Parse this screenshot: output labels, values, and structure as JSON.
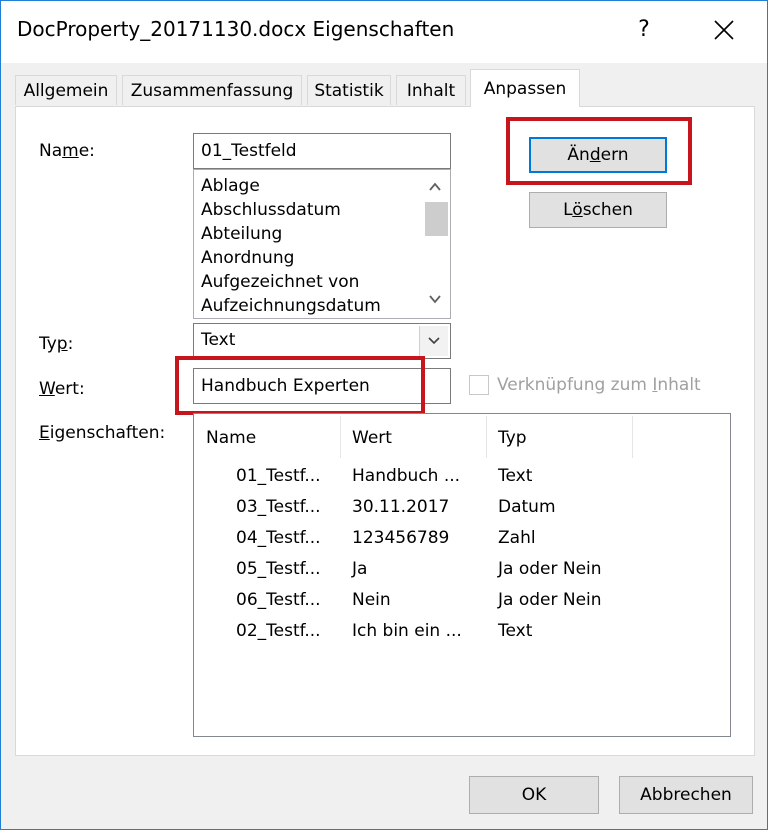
{
  "window": {
    "title": "DocProperty_20171130.docx Eigenschaften",
    "help": "?"
  },
  "tabs": [
    {
      "label": "Allgemein"
    },
    {
      "label": "Zusammenfassung"
    },
    {
      "label": "Statistik"
    },
    {
      "label": "Inhalt"
    },
    {
      "label": "Anpassen",
      "active": true
    }
  ],
  "form": {
    "name_label_pre": "Na",
    "name_label_u": "m",
    "name_label_post": "e:",
    "name_value": "01_Testfeld",
    "name_list": [
      "Ablage",
      "Abschlussdatum",
      "Abteilung",
      "Anordnung",
      "Aufgezeichnet von",
      "Aufzeichnungsdatum"
    ],
    "type_label_pre": "Ty",
    "type_label_u": "p",
    "type_label_post": ":",
    "type_value": "Text",
    "value_label_u": "W",
    "value_label_post": "ert:",
    "value_value": "Handbuch Experten",
    "link_checkbox_pre": "Verknüpfung zum ",
    "link_checkbox_u": "I",
    "link_checkbox_post": "nhalt",
    "link_checked": false,
    "props_label_u": "E",
    "props_label_post": "igenschaften:"
  },
  "buttons": {
    "change_pre": "Än",
    "change_u": "d",
    "change_post": "ern",
    "delete_pre": "L",
    "delete_u": "ö",
    "delete_post": "schen",
    "ok": "OK",
    "cancel": "Abbrechen"
  },
  "properties": {
    "columns": [
      "Name",
      "Wert",
      "Typ"
    ],
    "rows": [
      {
        "name": "01_Testf...",
        "value": "Handbuch ...",
        "type": "Text"
      },
      {
        "name": "03_Testf...",
        "value": "30.11.2017",
        "type": "Datum"
      },
      {
        "name": "04_Testf...",
        "value": "123456789",
        "type": "Zahl"
      },
      {
        "name": "05_Testf...",
        "value": "Ja",
        "type": "Ja oder Nein"
      },
      {
        "name": "06_Testf...",
        "value": "Nein",
        "type": "Ja oder Nein"
      },
      {
        "name": "02_Testf...",
        "value": "Ich bin ein ...",
        "type": "Text"
      }
    ]
  },
  "colors": {
    "highlight_border": "#c4161c",
    "focus_border": "#0078d7"
  }
}
